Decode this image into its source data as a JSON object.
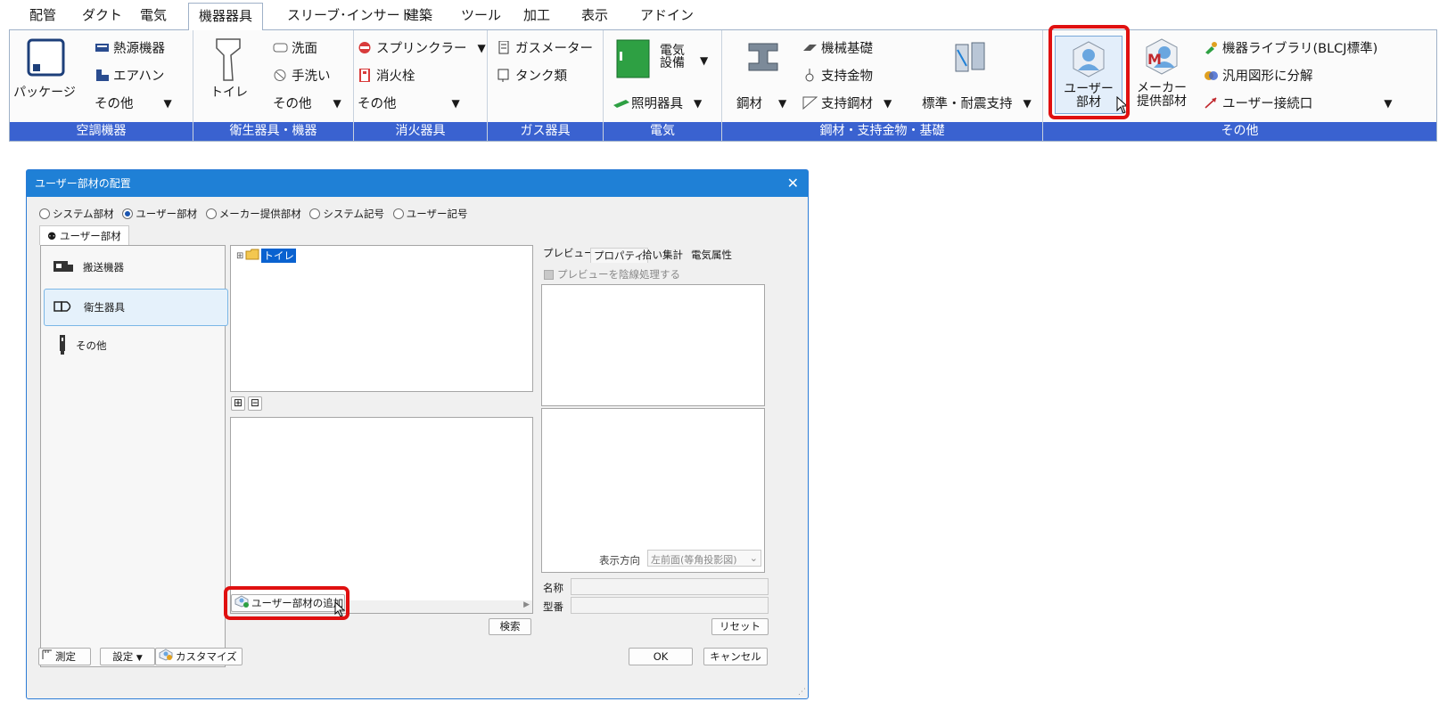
{
  "menu": [
    "配管",
    "ダクト",
    "電気",
    "機器器具",
    "スリーブ･インサート",
    "建築",
    "ツール",
    "加工",
    "表示",
    "アドイン"
  ],
  "ribbon": {
    "hvac": {
      "label": "空調機器",
      "package": "パッケージ",
      "heat_source": "熱源機器",
      "air_handler": "エアハン",
      "other": "その他"
    },
    "sanitary": {
      "label": "衛生器具・機器",
      "toilet": "トイレ",
      "washbasin": "洗面",
      "handwash": "手洗い",
      "other": "その他"
    },
    "fire": {
      "label": "消火器具",
      "sprinkler": "スプリンクラー",
      "hydrant": "消火栓",
      "other": "その他"
    },
    "gas": {
      "label": "ガス器具",
      "gas_meter": "ガスメーター",
      "tank": "タンク類"
    },
    "electric": {
      "label": "電気",
      "equipment_line1": "電気",
      "equipment_line2": "設備",
      "lighting": "照明器具"
    },
    "steel": {
      "label": "鋼材・支持金物・基礎",
      "steel": "鋼材",
      "machine_base": "機械基礎",
      "support_hardware": "支持金物",
      "support_steel": "支持鋼材",
      "standard_seismic": "標準・耐震支持"
    },
    "other": {
      "label": "その他",
      "user_part_line1": "ユーザー",
      "user_part_line2": "部材",
      "maker_part_line1": "メーカー",
      "maker_part_line2": "提供部材",
      "library": "機器ライブラリ(BLCJ標準)",
      "decompose": "汎用図形に分解",
      "user_connection": "ユーザー接続口"
    }
  },
  "dialog": {
    "title": "ユーザー部材の配置",
    "radios": [
      {
        "label": "システム部材",
        "selected": false
      },
      {
        "label": "ユーザー部材",
        "selected": true
      },
      {
        "label": "メーカー提供部材",
        "selected": false
      },
      {
        "label": "システム記号",
        "selected": false
      },
      {
        "label": "ユーザー記号",
        "selected": false
      }
    ],
    "main_tab": "ユーザー部材",
    "categories": [
      "搬送機器",
      "衛生器具",
      "その他"
    ],
    "tree_node": "トイレ",
    "add_button": "ユーザー部材の追加",
    "search_button": "検索",
    "preview_tabs": [
      "プレビュー",
      "プロパティ",
      "拾い集計",
      "電気属性"
    ],
    "hidden_line_checkbox": "プレビューを陰線処理する",
    "view_direction_label": "表示方向",
    "view_direction_value": "左前面(等角投影図)",
    "name_label": "名称",
    "model_label": "型番",
    "reset_button": "リセット",
    "measure_button": "測定",
    "settings_button": "設定",
    "customize_button": "カスタマイズ",
    "ok_button": "OK",
    "cancel_button": "キャンセル"
  },
  "colors": {
    "ribbon_group_label_bg": "#3a62d0",
    "title_bar": "#1f80d6",
    "highlight": "#e01010"
  }
}
